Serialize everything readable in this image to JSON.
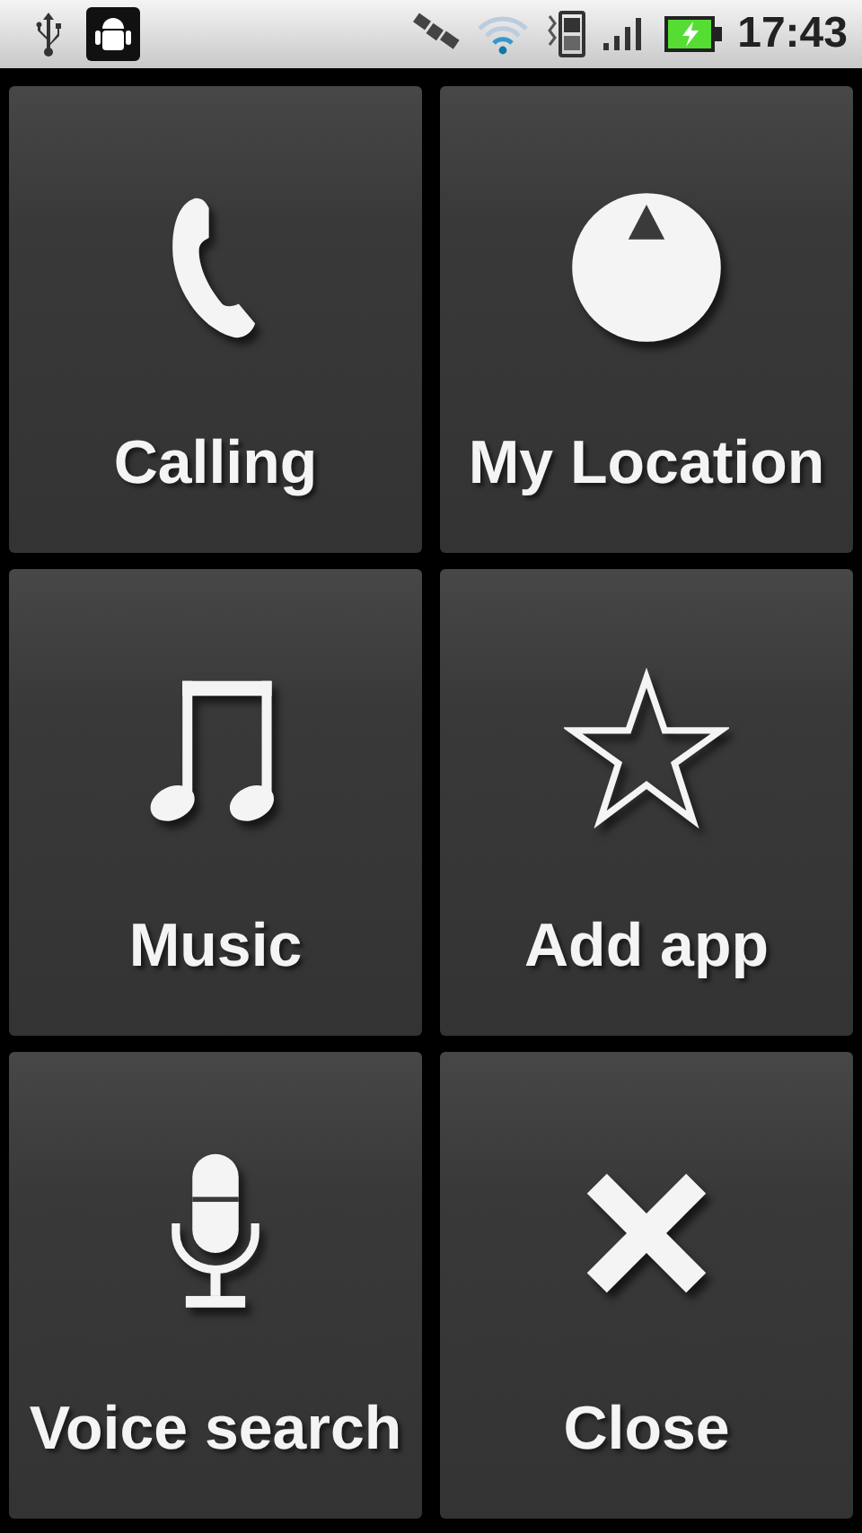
{
  "status_bar": {
    "time": "17:43"
  },
  "tiles": [
    {
      "kind": "phone",
      "label": "Calling"
    },
    {
      "kind": "location",
      "label": "My Location"
    },
    {
      "kind": "music",
      "label": "Music"
    },
    {
      "kind": "star",
      "label": "Add app"
    },
    {
      "kind": "mic",
      "label": "Voice search"
    },
    {
      "kind": "close",
      "label": "Close"
    }
  ]
}
